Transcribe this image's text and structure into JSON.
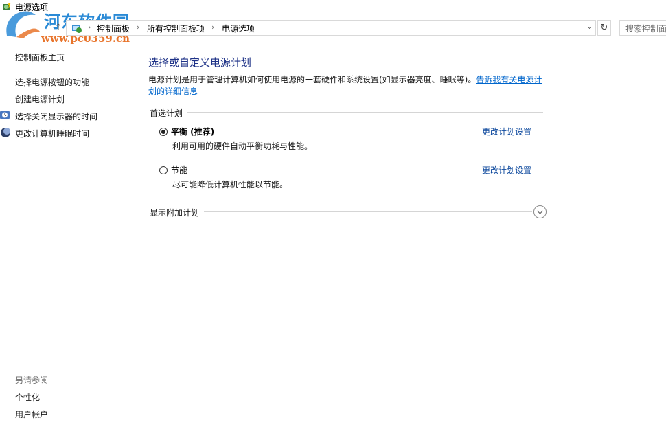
{
  "window": {
    "title": "电源选项"
  },
  "watermark": {
    "brand": "河东软件园",
    "url": "www.pc0359.cn"
  },
  "address_bar": {
    "crumbs": [
      "控制面板",
      "所有控制面板项",
      "电源选项"
    ],
    "separator": "›"
  },
  "search": {
    "placeholder": "搜索控制面"
  },
  "sidebar": {
    "home": "控制面板主页",
    "items": [
      {
        "label": "选择电源按钮的功能"
      },
      {
        "label": "创建电源计划"
      },
      {
        "label": "选择关闭显示器的时间"
      },
      {
        "label": "更改计算机睡眠时间"
      }
    ],
    "see_also_title": "另请参阅",
    "see_also": [
      {
        "label": "个性化"
      },
      {
        "label": "用户帐户"
      }
    ]
  },
  "main": {
    "heading": "选择或自定义电源计划",
    "description": "电源计划是用于管理计算机如何使用电源的一套硬件和系统设置(如显示器亮度、睡眠等)。",
    "description_link": "告诉我有关电源计划的详细信息",
    "preferred_section": "首选计划",
    "plans": [
      {
        "name": "平衡 (推荐)",
        "description": "利用可用的硬件自动平衡功耗与性能。",
        "change_label": "更改计划设置",
        "selected": true
      },
      {
        "name": "节能",
        "description": "尽可能降低计算机性能以节能。",
        "change_label": "更改计划设置",
        "selected": false
      }
    ],
    "additional_section": "显示附加计划"
  },
  "colors": {
    "heading": "#1e3287",
    "link": "#0066cc",
    "watermark_blue": "#2a8ad6",
    "watermark_orange": "#e8742b"
  }
}
